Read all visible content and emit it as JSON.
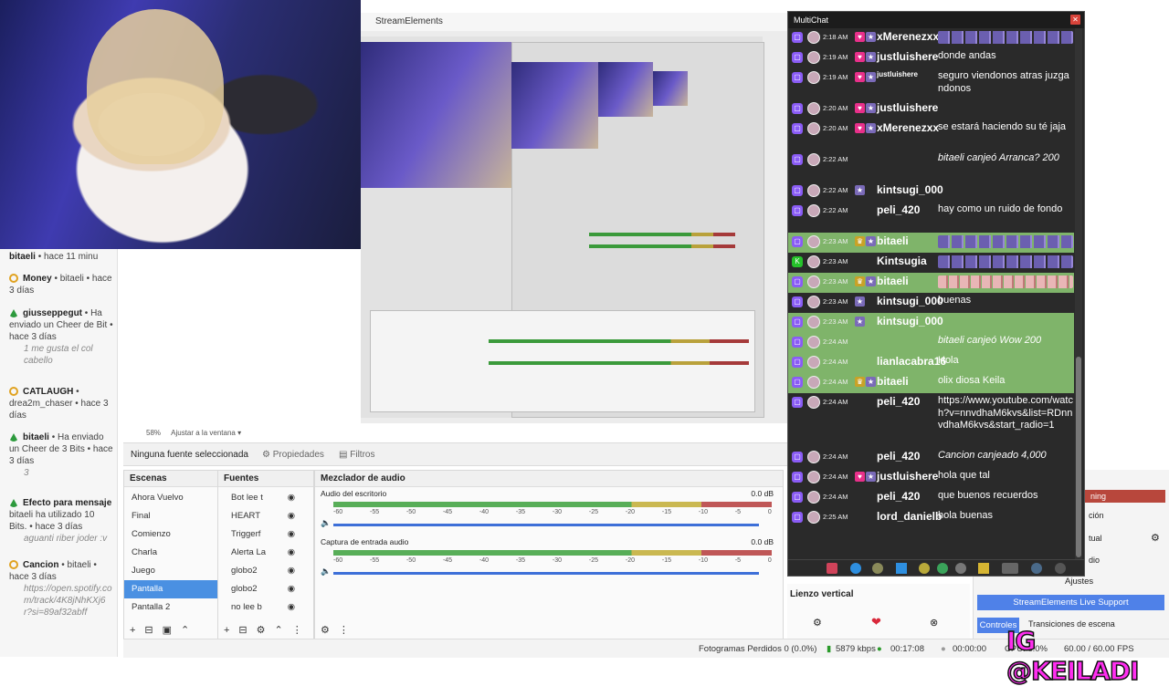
{
  "window": {
    "title": "StreamElements"
  },
  "preview": {
    "zoom": "58%",
    "fit_label": "Ajustar a la ventana"
  },
  "notifications": [
    {
      "title": "bitaeli",
      "meta": "• hace 11 minu",
      "icon": "heart"
    },
    {
      "title": "Money",
      "meta": "• bitaeli • hace 3 días",
      "icon": "heart"
    },
    {
      "title": "giusseppegut",
      "meta": "• Ha enviado un Cheer de Bit • hace 3 días",
      "msg": "1 me gusta el col cabello",
      "icon": "bits"
    },
    {
      "title": "CATLAUGH",
      "meta": "• drea2m_chaser • hace 3 días",
      "msg": "",
      "icon": "heart"
    },
    {
      "title": "bitaeli",
      "meta": "• Ha enviado un Cheer de 3 Bits • hace 3 días",
      "msg": "3",
      "icon": "bits"
    },
    {
      "title": "Efecto para mensaje",
      "meta": "bitaeli ha utilizado 10 Bits. • hace 3 días",
      "msg": "aguanti riber joder :v",
      "icon": "bits"
    },
    {
      "title": "Cancion",
      "meta": "• bitaeli • hace 3 días",
      "msg": "https://open.spotify.com/track/4K8jNhKXj6r?si=89af32abff",
      "icon": "heart"
    }
  ],
  "source_bar": {
    "no_source": "Ninguna fuente seleccionada",
    "properties": "Propiedades",
    "filters": "Filtros"
  },
  "scenes": {
    "header": "Escenas",
    "items": [
      "Ahora Vuelvo",
      "Final",
      "Comienzo",
      "Charla",
      "Juego",
      "Pantalla",
      "Pantalla 2"
    ],
    "selected": "Pantalla"
  },
  "sources": {
    "header": "Fuentes",
    "items": [
      "Bot lee t",
      "HEART",
      "Triggerf",
      "Alerta La",
      "globo2",
      "globo2",
      "no lee b"
    ]
  },
  "mixer": {
    "header": "Mezclador de audio",
    "channels": [
      {
        "name": "Audio del escritorio",
        "db": "0.0 dB"
      },
      {
        "name": "Captura de entrada audio",
        "db": "0.0 dB"
      }
    ],
    "ticks": [
      "-60",
      "-55",
      "-50",
      "-45",
      "-40",
      "-35",
      "-30",
      "-25",
      "-20",
      "-15",
      "-10",
      "-5",
      "0"
    ]
  },
  "multichat": {
    "title": "MultiChat",
    "messages": [
      {
        "time": "2:18 AM",
        "user": "xMerenezxx",
        "text": "",
        "emotes": "purple",
        "badges": [
          "heart",
          "sub"
        ],
        "hl": false
      },
      {
        "time": "2:19 AM",
        "user": "justluishere",
        "text": "donde andas",
        "badges": [
          "heart",
          "sub"
        ],
        "hl": false
      },
      {
        "time": "2:19 AM",
        "user": "justluishere",
        "text": "seguro viendonos atras juzgandonos",
        "badges": [
          "heart",
          "sub"
        ],
        "hl": false,
        "small_user": true
      },
      {
        "time": "2:20 AM",
        "user": "justluishere",
        "text": "",
        "badges": [
          "heart",
          "sub"
        ],
        "hl": false
      },
      {
        "time": "2:20 AM",
        "user": "xMerenezxx",
        "text": "se estará haciendo su té jaja",
        "badges": [
          "heart",
          "sub"
        ],
        "hl": false
      },
      {
        "time": "2:22 AM",
        "user": "",
        "text": "bitaeli canjeó Arranca? 200",
        "badges": [],
        "hl": false,
        "redeem": true
      },
      {
        "time": "2:22 AM",
        "user": "kintsugi_000",
        "text": "",
        "badges": [
          "sub"
        ],
        "hl": false
      },
      {
        "time": "2:22 AM",
        "user": "peli_420",
        "text": "hay como un ruido de fondo",
        "badges": [],
        "hl": false
      },
      {
        "time": "2:23 AM",
        "user": "bitaeli",
        "text": "",
        "emotes": "purple",
        "badges": [
          "crown",
          "sub"
        ],
        "hl": true
      },
      {
        "time": "2:23 AM",
        "user": "Kintsugia",
        "text": "",
        "emotes": "purple",
        "badges": [],
        "hl": false,
        "kick": true
      },
      {
        "time": "2:23 AM",
        "user": "bitaeli",
        "text": "",
        "emotes": "pink",
        "badges": [
          "crown",
          "sub"
        ],
        "hl": true
      },
      {
        "time": "2:23 AM",
        "user": "kintsugi_000",
        "text": "buenas",
        "badges": [
          "sub"
        ],
        "hl": false
      },
      {
        "time": "2:23 AM",
        "user": "kintsugi_000",
        "text": "",
        "badges": [
          "sub"
        ],
        "hl": true
      },
      {
        "time": "2:24 AM",
        "user": "",
        "text": "bitaeli canjeó Wow 200",
        "badges": [],
        "hl": true,
        "redeem": true
      },
      {
        "time": "2:24 AM",
        "user": "lianlacabra16",
        "text": "Hola",
        "badges": [],
        "hl": true
      },
      {
        "time": "2:24 AM",
        "user": "bitaeli",
        "text": "olix diosa Keila",
        "badges": [
          "crown",
          "sub"
        ],
        "hl": true
      },
      {
        "time": "2:24 AM",
        "user": "peli_420",
        "text": "https://www.youtube.com/watch?v=nnvdhaM6kvs&list=RDnnvdhaM6kvs&start_radio=1",
        "badges": [],
        "hl": false
      },
      {
        "time": "2:24 AM",
        "user": "peli_420",
        "text": "Cancion canjeado 4,000",
        "badges": [],
        "hl": false,
        "redeem": true
      },
      {
        "time": "2:24 AM",
        "user": "justluishere",
        "text": "hola que tal",
        "badges": [
          "heart",
          "sub"
        ],
        "hl": false
      },
      {
        "time": "2:24 AM",
        "user": "peli_420",
        "text": "que buenos recuerdos",
        "badges": [],
        "hl": false
      },
      {
        "time": "2:25 AM",
        "user": "lord_danielb",
        "text": "hola buenas",
        "badges": [],
        "hl": false
      }
    ]
  },
  "right_panel": {
    "lienzo": "Lienzo vertical",
    "ajustes": "Ajustes",
    "support": "StreamElements Live Support",
    "tabs": [
      "Controles",
      "Transiciones de escena"
    ],
    "partial_labels": [
      "ning",
      "ción",
      "tual",
      "dio"
    ]
  },
  "status": {
    "frames": "Fotogramas Perdidos 0 (0.0%)",
    "kbps": "5879 kbps",
    "time1": "00:17:08",
    "time2": "00:00:00",
    "cpu": "CPU: 6.0%",
    "fps": "60.00 / 60.00 FPS"
  },
  "overlay": {
    "ig": "IG @KEILADI"
  }
}
